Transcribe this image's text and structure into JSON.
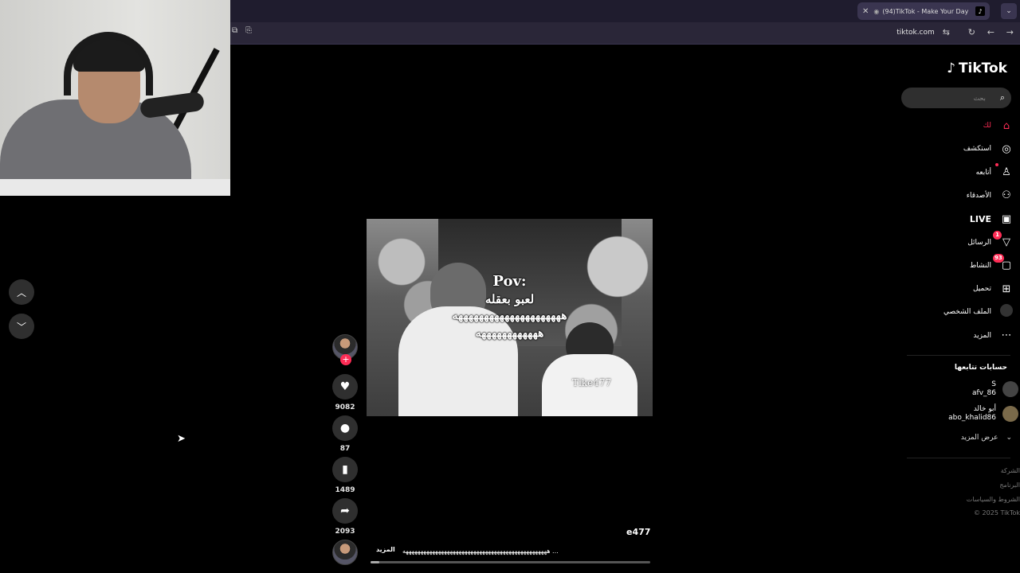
{
  "browser": {
    "tab_title": "(94)TikTok - Make Your Day",
    "url": "tiktok.com"
  },
  "tiktok": {
    "logo_text": "TikTok",
    "search_placeholder": "بحث",
    "menu": [
      {
        "label": "لك",
        "icon": "home-icon",
        "active": true
      },
      {
        "label": "استكشف",
        "icon": "compass-icon"
      },
      {
        "label": "أتابعه",
        "icon": "user-follow-icon",
        "dot": true
      },
      {
        "label": "الأصدقاء",
        "icon": "friends-icon"
      },
      {
        "label": "LIVE",
        "icon": "live-icon"
      },
      {
        "label": "الرسائل",
        "icon": "messages-icon",
        "badge": "1"
      },
      {
        "label": "النشاط",
        "icon": "activity-icon",
        "badge": "93"
      },
      {
        "label": "تحميل",
        "icon": "upload-icon"
      },
      {
        "label": "الملف الشخصي",
        "icon": "profile-icon"
      },
      {
        "label": "المزيد",
        "icon": "more-icon"
      }
    ],
    "following_title": "حسابات تتابعها",
    "following": [
      {
        "name": "S",
        "handle": "afv_86"
      },
      {
        "name": "أبو خالد",
        "handle": "abo_khalid86"
      }
    ],
    "show_more": "عرض المزيد",
    "footer": [
      "الشركة",
      "البرنامج",
      "الشروط والسياسات",
      "© 2025 TikTok"
    ]
  },
  "video": {
    "overlay_line1": "Pov:",
    "overlay_line2": "لعبو بعقله",
    "overlay_line3": "هههههههههههههههههههههه",
    "overlay_line4": "ههههههههههههه",
    "watermark": "Tike477",
    "author": "e477",
    "caption": "هههههههههههههههههههههههههههههههههههههههههههههههههه ...",
    "more_label": "المزيد",
    "progress": 0.03
  },
  "actions": {
    "likes": "9082",
    "comments": "87",
    "saves": "1489",
    "shares": "2093"
  }
}
